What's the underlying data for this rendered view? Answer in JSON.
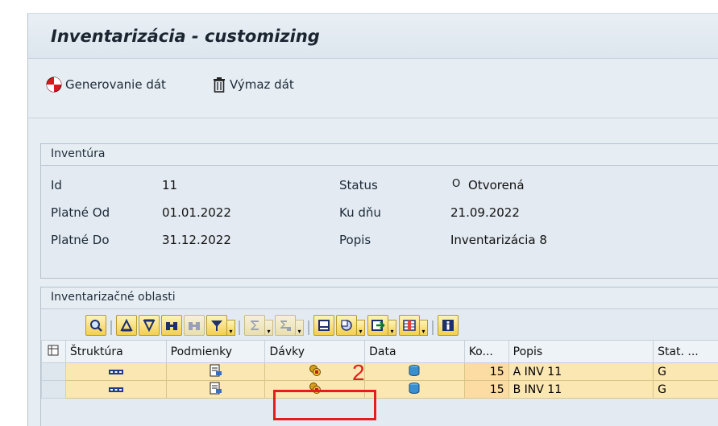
{
  "title": "Inventarizácia - customizing",
  "toolbar": {
    "generate_label": "Generovanie dát",
    "delete_label": "Výmaz dát"
  },
  "inventura": {
    "group_title": "Inventúra",
    "id_label": "Id",
    "id_value": "11",
    "valid_from_label": "Platné Od",
    "valid_from_value": "01.01.2022",
    "valid_to_label": "Platné Do",
    "valid_to_value": "31.12.2022",
    "status_label": "Status",
    "status_icon": "O",
    "status_value": "Otvorená",
    "as_of_label": "Ku dňu",
    "as_of_value": "21.09.2022",
    "description_label": "Popis",
    "description_value": "Inventarizácia 8"
  },
  "areas": {
    "group_title": "Inventarizačné oblasti",
    "columns": [
      "Štruktúra",
      "Podmienky",
      "Dávky",
      "Data",
      "Ko...",
      "Popis",
      "Stat. ..."
    ],
    "rows": [
      {
        "ko": "15",
        "popis": "A INV 11",
        "stat": "G"
      },
      {
        "ko": "15",
        "popis": "B INV 11",
        "stat": "G"
      }
    ]
  },
  "annotation": {
    "number": "2",
    "color": "#e41d1d"
  }
}
